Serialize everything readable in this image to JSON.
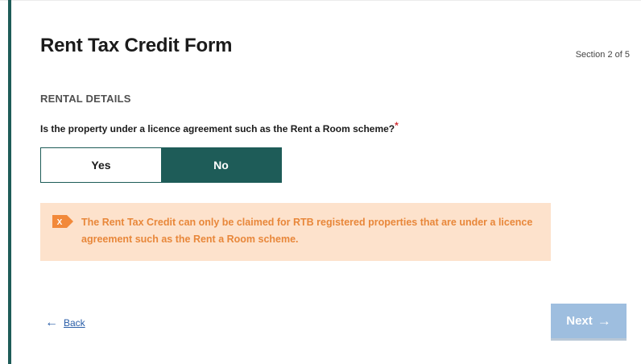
{
  "form": {
    "title": "Rent Tax Credit Form",
    "section": "Section 2 of 5",
    "heading": "RENTAL DETAILS",
    "question": "Is the property under a licence agreement such as the Rent a Room scheme?",
    "required_marker": "*"
  },
  "toggle": {
    "options": [
      "Yes",
      "No"
    ],
    "selected": "No"
  },
  "alert": {
    "icon": "error-x-icon",
    "icon_glyph": "X",
    "message": "The Rent Tax Credit can only be claimed for RTB registered properties that are under a licence agreement such as the Rent a Room scheme."
  },
  "nav": {
    "back_arrow": "←",
    "back_label": "Back",
    "next_label": "Next",
    "next_arrow": "→"
  },
  "colors": {
    "accent": "#1e5c58",
    "alert_background": "#fde2cc",
    "alert_text": "#e8873a",
    "required": "#d13438",
    "link": "#2a5ea8",
    "next_disabled": "#9ebedf"
  }
}
